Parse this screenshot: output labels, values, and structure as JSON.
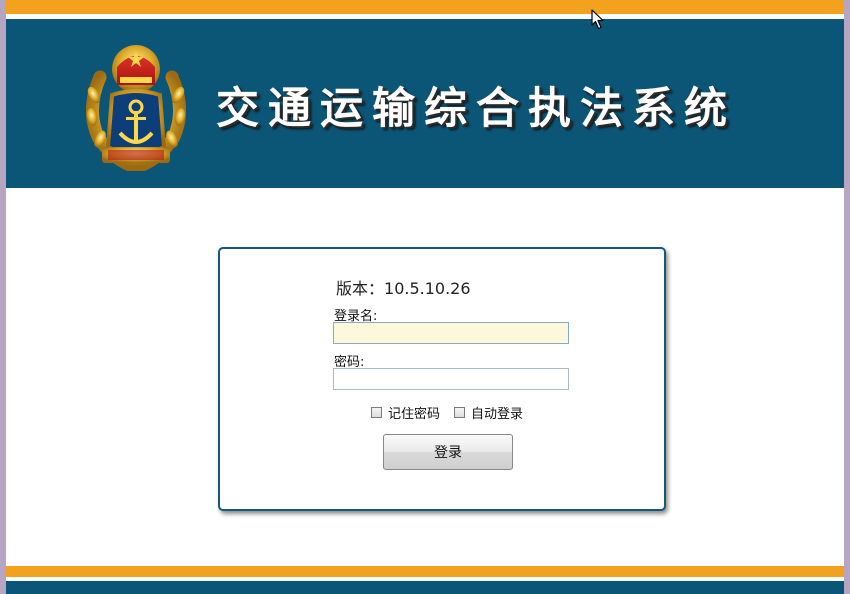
{
  "header": {
    "title": "交通运输综合执法系统",
    "emblem_icon": "law-enforcement-emblem-icon"
  },
  "login": {
    "version_label": "版本：",
    "version": "10.5.10.26",
    "username_label": "登录名:",
    "username_value": "",
    "password_label": "密码:",
    "password_value": "",
    "remember_password_label": "记住密码",
    "auto_login_label": "自动登录",
    "login_button_label": "登录"
  },
  "colors": {
    "banner": "#0b5577",
    "stripe": "#f2a21c",
    "input_focus": "#fcf8da"
  }
}
